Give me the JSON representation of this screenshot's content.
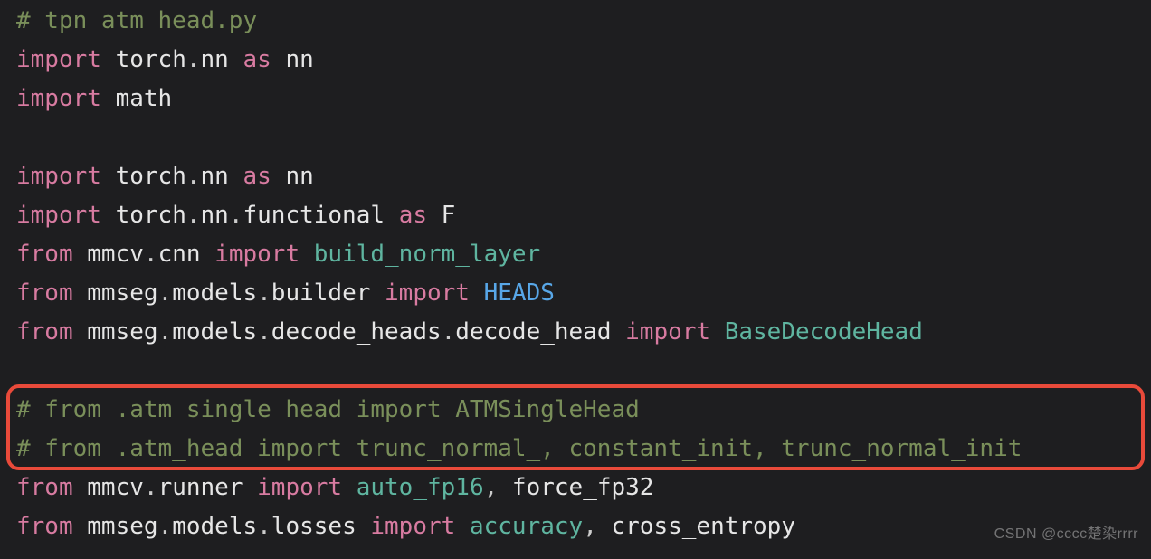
{
  "lines": {
    "l1": {
      "comment": "# tpn_atm_head.py"
    },
    "l2": {
      "kw1": "import",
      "mod1": "torch",
      "dot1": ".",
      "mod2": "nn",
      "kw2": "as",
      "alias": "nn"
    },
    "l3": {
      "kw1": "import",
      "mod1": "math"
    },
    "l4": {
      "blank": ""
    },
    "l5": {
      "kw1": "import",
      "mod1": "torch",
      "dot1": ".",
      "mod2": "nn",
      "kw2": "as",
      "alias": "nn"
    },
    "l6": {
      "kw1": "import",
      "mod1": "torch",
      "dot1": ".",
      "mod2": "nn",
      "dot2": ".",
      "mod3": "functional",
      "kw2": "as",
      "alias": "F"
    },
    "l7": {
      "kw1": "from",
      "mod1": "mmcv",
      "dot1": ".",
      "mod2": "cnn",
      "kw2": "import",
      "name1": "build_norm_layer"
    },
    "l8": {
      "kw1": "from",
      "mod1": "mmseg",
      "dot1": ".",
      "mod2": "models",
      "dot2": ".",
      "mod3": "builder",
      "kw2": "import",
      "name1": "HEADS"
    },
    "l9": {
      "kw1": "from",
      "mod1": "mmseg",
      "dot1": ".",
      "mod2": "models",
      "dot2": ".",
      "mod3": "decode_heads",
      "dot3": ".",
      "mod4": "decode_head",
      "kw2": "import",
      "name1": "BaseDecodeHead"
    },
    "l10": {
      "blank": ""
    },
    "l11": {
      "comment": "# from .atm_single_head import ATMSingleHead"
    },
    "l12": {
      "comment": "# from .atm_head import trunc_normal_, constant_init, trunc_normal_init"
    },
    "l13": {
      "kw1": "from",
      "mod1": "mmcv",
      "dot1": ".",
      "mod2": "runner",
      "kw2": "import",
      "name1": "auto_fp16",
      "comma1": ",",
      "sp1": " ",
      "name2": "force_fp32"
    },
    "l14": {
      "kw1": "from",
      "mod1": "mmseg",
      "dot1": ".",
      "mod2": "models",
      "dot2": ".",
      "mod3": "losses",
      "kw2": "import",
      "name1": "accuracy",
      "comma1": ",",
      "sp1": " ",
      "name2": "cross_entropy"
    }
  },
  "watermark": "CSDN @cccc楚染rrrr"
}
